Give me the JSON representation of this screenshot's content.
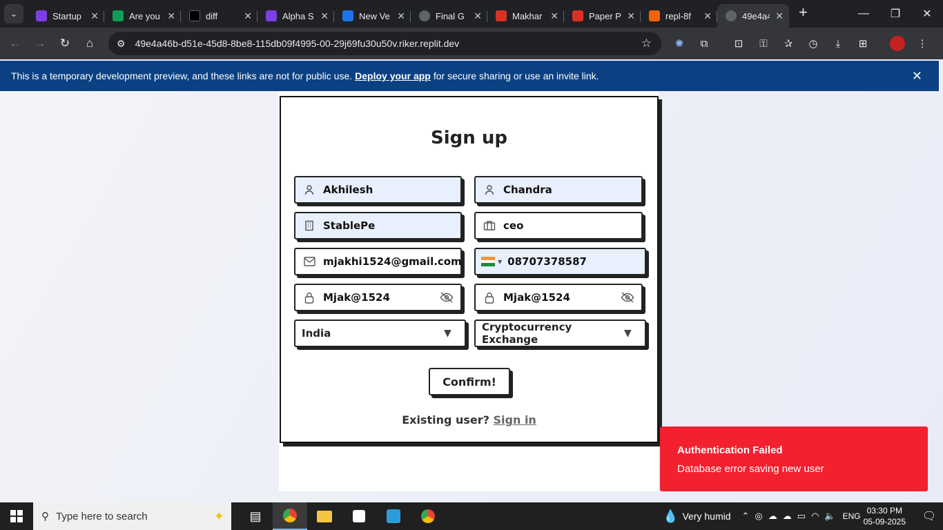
{
  "browser": {
    "tabs": [
      {
        "title": "Startup",
        "color": "#7b3fe4"
      },
      {
        "title": "Are you",
        "color": "#0f9d58"
      },
      {
        "title": "diff",
        "color": "#000000"
      },
      {
        "title": "Alpha S",
        "color": "#7b3fe4"
      },
      {
        "title": "New Ve",
        "color": "#1a73e8"
      },
      {
        "title": "Final G",
        "color": "#5f6368"
      },
      {
        "title": "Makhar",
        "color": "#d93025"
      },
      {
        "title": "Paper P",
        "color": "#d93025"
      },
      {
        "title": "repl-8f",
        "color": "#f26207"
      },
      {
        "title": "49e4a4",
        "color": "#5f6368"
      }
    ],
    "url": "49e4a46b-d51e-45d8-8be8-115db09f4995-00-29j69fu30u50v.riker.replit.dev"
  },
  "banner": {
    "text_before": "This is a temporary development preview, and these links are not for public use.",
    "link": "Deploy your app",
    "text_after": "for secure sharing or use an invite link."
  },
  "form": {
    "title": "Sign up",
    "first_name": "Akhilesh",
    "last_name": "Chandra",
    "company": "StablePe",
    "role": "ceo",
    "email": "mjakhi1524@gmail.com",
    "phone": "08707378587",
    "password": "Mjak@1524",
    "confirm_password": "Mjak@1524",
    "country": "India",
    "industry": "Cryptocurrency Exchange",
    "confirm_label": "Confirm!",
    "existing_text": "Existing user?",
    "signin_link": "Sign in"
  },
  "toast": {
    "title": "Authentication Failed",
    "message": "Database error saving new user",
    "color": "#f3202f"
  },
  "taskbar": {
    "search_placeholder": "Type here to search",
    "weather": "Very humid",
    "language": "ENG",
    "time": "03:30 PM",
    "date": "05-09-2025"
  }
}
